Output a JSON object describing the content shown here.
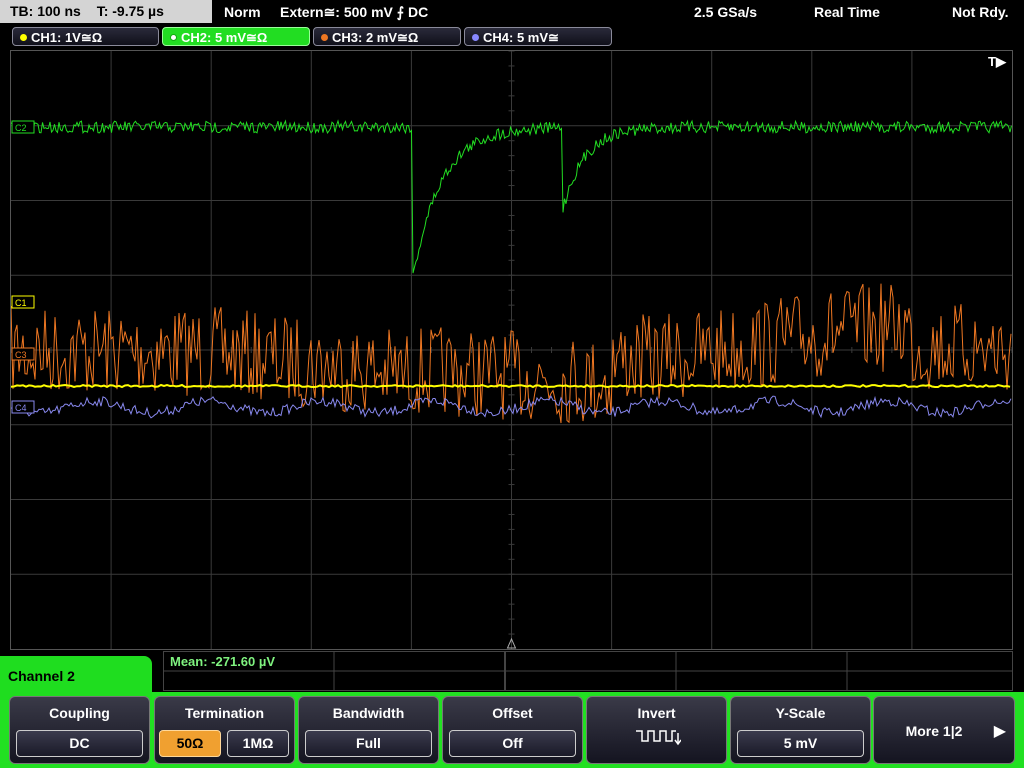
{
  "top": {
    "timebase": "TB: 100 ns",
    "trigger_time": "T: -9.75 µs",
    "mode": "Norm",
    "trigger_source": "Extern≅: 500 mV ⨍ DC",
    "sample_rate": "2.5 GSa/s",
    "acq_mode": "Real Time",
    "status": "Not Rdy."
  },
  "channels": [
    {
      "label": "CH1: 1V≅Ω",
      "color": "#ffff00",
      "active": false
    },
    {
      "label": "CH2: 5 mV≅Ω",
      "color": "#22dd22",
      "active": true
    },
    {
      "label": "CH3: 2 mV≅Ω",
      "color": "#ee7722",
      "active": false
    },
    {
      "label": "CH4: 5 mV≅",
      "color": "#8888ff",
      "active": false
    }
  ],
  "scope": {
    "trigger_marker": "T▶",
    "markers": {
      "c1": "C1",
      "c2": "C2",
      "c3": "C3",
      "c4": "C4"
    },
    "colors": {
      "ch1": "#ffff00",
      "ch2": "#22dd22",
      "ch3": "#ee7722",
      "ch4": "#8888ee",
      "grid": "#3a3a3a"
    }
  },
  "measurement": {
    "mean": "Mean: -271.60 µV"
  },
  "panel": {
    "title": "Channel 2",
    "coupling": {
      "label": "Coupling",
      "value": "DC"
    },
    "termination": {
      "label": "Termination",
      "opt1": "50Ω",
      "opt2": "1MΩ"
    },
    "bandwidth": {
      "label": "Bandwidth",
      "value": "Full"
    },
    "offset": {
      "label": "Offset",
      "value": "Off"
    },
    "invert": {
      "label": "Invert",
      "icon": "inverted-square-wave-icon"
    },
    "yscale": {
      "label": "Y-Scale",
      "value": "5 mV"
    },
    "more": {
      "label": "More 1|2",
      "icon": "play-arrow-icon"
    }
  }
}
